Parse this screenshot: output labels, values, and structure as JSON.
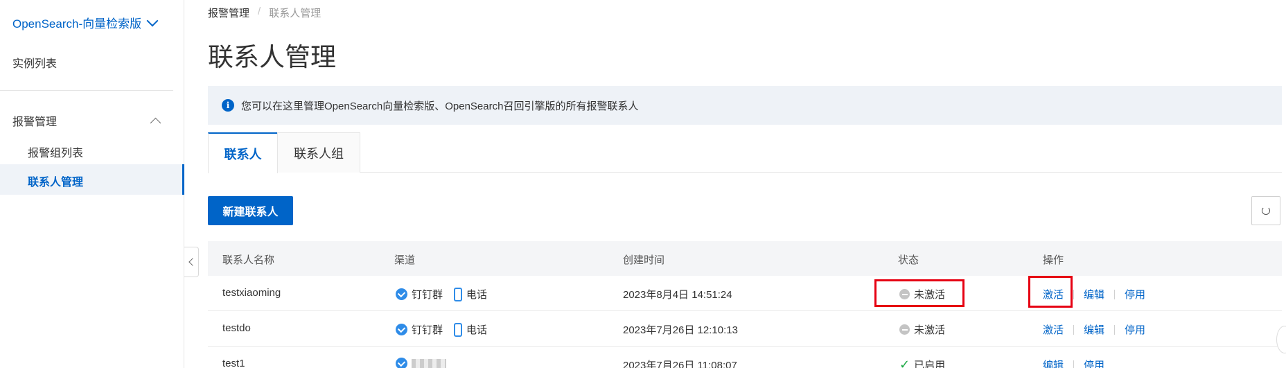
{
  "sidebar": {
    "product": "OpenSearch-向量检索版",
    "instance_list": "实例列表",
    "alert_group": "报警管理",
    "items": [
      {
        "label": "报警组列表"
      },
      {
        "label": "联系人管理"
      }
    ]
  },
  "breadcrumb": {
    "parent": "报警管理",
    "sep": "/",
    "current": "联系人管理"
  },
  "page_title": "联系人管理",
  "notice": {
    "icon": "i",
    "text": "您可以在这里管理OpenSearch向量检索版、OpenSearch召回引擎版的所有报警联系人"
  },
  "tabs": [
    {
      "label": "联系人"
    },
    {
      "label": "联系人组"
    }
  ],
  "toolbar": {
    "new_contact": "新建联系人"
  },
  "table": {
    "columns": [
      "联系人名称",
      "渠道",
      "创建时间",
      "状态",
      "操作"
    ],
    "rows": [
      {
        "name": "testxiaoming",
        "ch1": "钉钉群",
        "ch2": "电话",
        "created": "2023年8月4日 14:51:24",
        "status": "未激活",
        "ops": [
          "激活",
          "编辑",
          "停用"
        ]
      },
      {
        "name": "testdo",
        "ch1": "钉钉群",
        "ch2": "电话",
        "created": "2023年7月26日 12:10:13",
        "status": "未激活",
        "ops": [
          "激活",
          "编辑",
          "停用"
        ]
      },
      {
        "name": "test1",
        "created": "2023年7月26日 11:08:07",
        "status": "已启用",
        "status_icon": "✓",
        "ops": [
          "编辑",
          "停用"
        ]
      }
    ]
  },
  "colors": {
    "accent": "#0064c8",
    "highlight": "#e60012",
    "success": "#1ba944"
  }
}
